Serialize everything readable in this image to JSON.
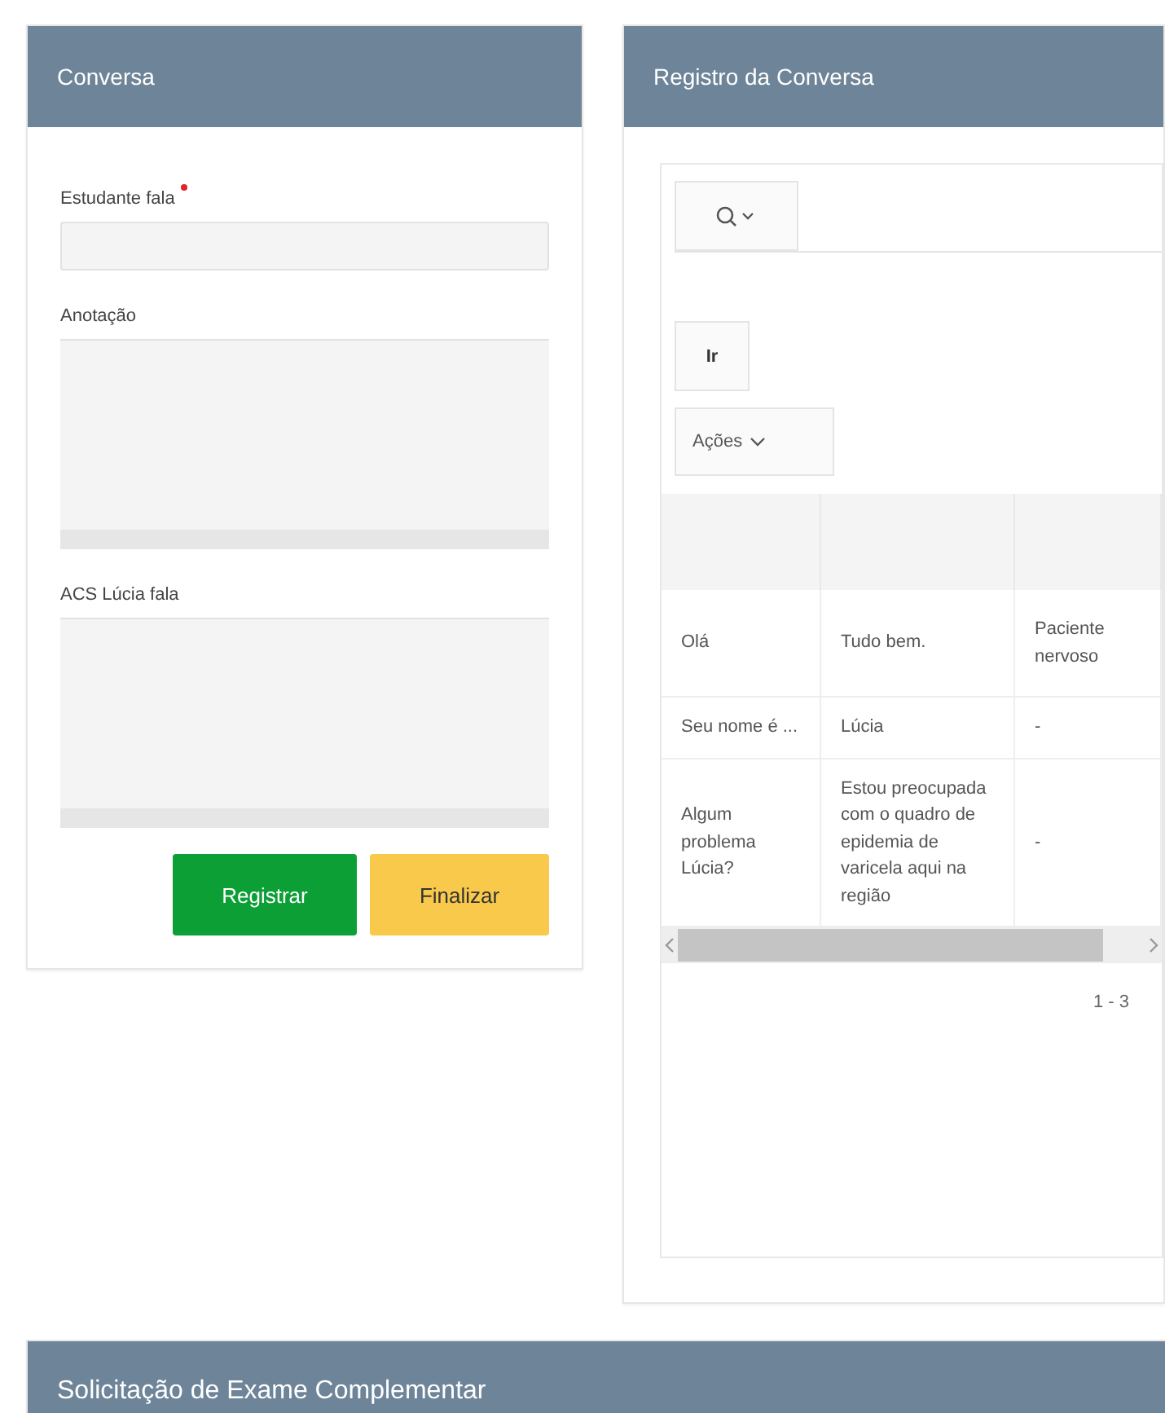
{
  "conversa": {
    "title": "Conversa",
    "fields": [
      {
        "label": "Estudante fala",
        "required": true,
        "kind": "input"
      },
      {
        "label": "Anotação",
        "required": false,
        "kind": "textarea"
      },
      {
        "label": "ACS Lúcia fala",
        "required": false,
        "kind": "textarea"
      }
    ],
    "buttons": [
      {
        "label": "Registrar",
        "kind": "primary"
      },
      {
        "label": "Finalizar",
        "kind": "warning"
      }
    ]
  },
  "registro": {
    "title": "Registro da Conversa",
    "go_button": "Ir",
    "actions_button": "Ações",
    "table": {
      "rows": [
        [
          "Olá",
          "Tudo bem.",
          "Paciente nervoso"
        ],
        [
          "Seu nome é ...",
          "Lúcia",
          "-"
        ],
        [
          "Algum problema Lúcia?",
          "Estou preocupada com o quadro de epidemia de varicela aqui na região",
          "-"
        ]
      ]
    },
    "pagination": "1 - 3"
  },
  "solicitacao": {
    "title": "Solicitação de Exame Complementar"
  }
}
